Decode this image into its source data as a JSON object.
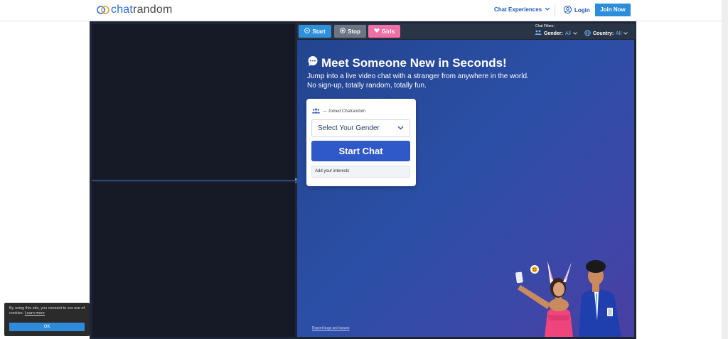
{
  "header": {
    "logo_part1": "chat",
    "logo_part2": "random",
    "nav_experiences": "Chat Experiences",
    "login": "Login",
    "join": "Join Now"
  },
  "toolbar": {
    "start": "Start",
    "stop": "Stop",
    "girls": "Girls",
    "filters_label": "Chat Filters:",
    "gender_label": "Gender:",
    "gender_value": "All",
    "country_label": "Country:",
    "country_value": "All"
  },
  "main": {
    "headline": "Meet Someone New in Seconds!",
    "subtext": "Jump into a live video chat with a stranger from anywhere in the world. No sign-up, totally random, totally fun.",
    "joined": "--- Joined Chatrandom",
    "gender_select": "Select Your Gender",
    "start_chat": "Start Chat",
    "interests_placeholder": "Add your interests",
    "report_link": "Report bugs and issues"
  },
  "cookie": {
    "text": "By using this site, you consent to our use of cookies.",
    "learn_more": "Learn more",
    "ok": "OK"
  },
  "colors": {
    "brand_blue": "#2d6fd6",
    "start_btn": "#2e8fdb",
    "stop_btn": "#6d7584",
    "girls_btn": "#ef6fa6",
    "start_chat": "#2f59c9"
  }
}
